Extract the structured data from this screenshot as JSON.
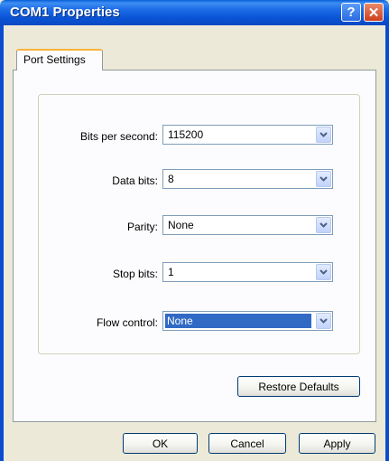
{
  "window": {
    "title": "COM1 Properties",
    "help_glyph": "?",
    "close_glyph": "✕"
  },
  "tabs": [
    {
      "label": "Port Settings"
    }
  ],
  "fields": {
    "bits_per_second": {
      "label": "Bits per second:",
      "value": "115200"
    },
    "data_bits": {
      "label": "Data bits:",
      "value": "8"
    },
    "parity": {
      "label": "Parity:",
      "value": "None"
    },
    "stop_bits": {
      "label": "Stop bits:",
      "value": "1"
    },
    "flow_control": {
      "label": "Flow control:",
      "value": "None"
    }
  },
  "buttons": {
    "restore_defaults": "Restore Defaults",
    "ok": "OK",
    "cancel": "Cancel",
    "apply": "Apply"
  },
  "icons": {
    "dropdown": "chevron-down-icon"
  },
  "colors": {
    "titlebar": "#0a54d6",
    "selection": "#316ac5",
    "tab_highlight": "#f8b33a"
  }
}
